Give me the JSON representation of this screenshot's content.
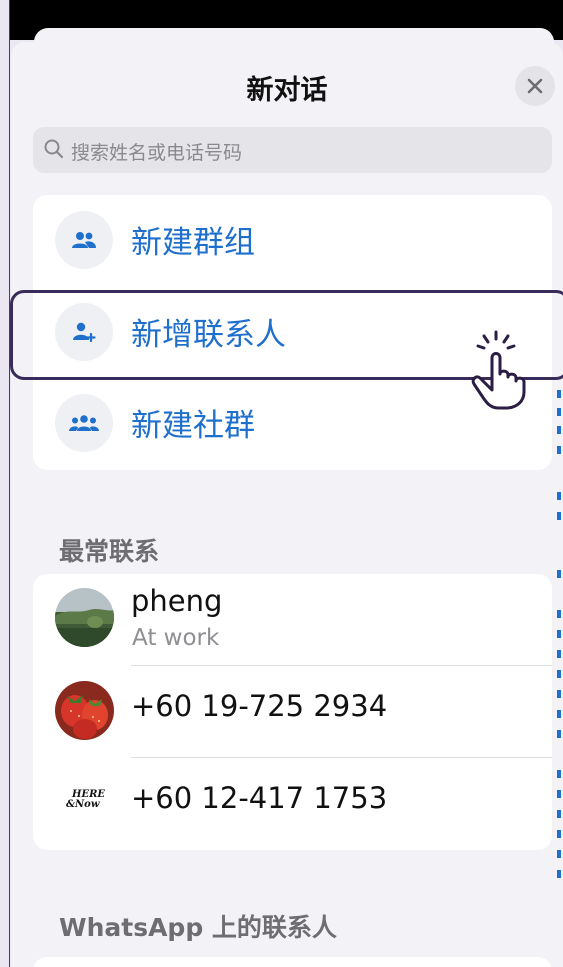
{
  "header": {
    "title": "新对话"
  },
  "search": {
    "placeholder": "搜索姓名或电话号码"
  },
  "actions": [
    {
      "label": "新建群组",
      "icon": "group-icon"
    },
    {
      "label": "新增联系人",
      "icon": "add-contact-icon"
    },
    {
      "label": "新建社群",
      "icon": "community-icon"
    }
  ],
  "frequent": {
    "header": "最常联系",
    "contacts": [
      {
        "name": "pheng",
        "status": "At work",
        "avatar": "landscape-avatar"
      },
      {
        "name": "+60 19-725 2934",
        "status": "",
        "avatar": "strawberry-avatar"
      },
      {
        "name": "+60 12-417 1753",
        "status": "",
        "avatar": "here-now-avatar",
        "avatar_text_1": "HERE",
        "avatar_text_2": "&Now"
      }
    ]
  },
  "whatsapp_section": {
    "header": "WhatsApp 上的联系人"
  },
  "colors": {
    "accent": "#1f6fcc",
    "highlight_border": "#3a2c5a",
    "sheet_bg": "#f2f2f7"
  }
}
